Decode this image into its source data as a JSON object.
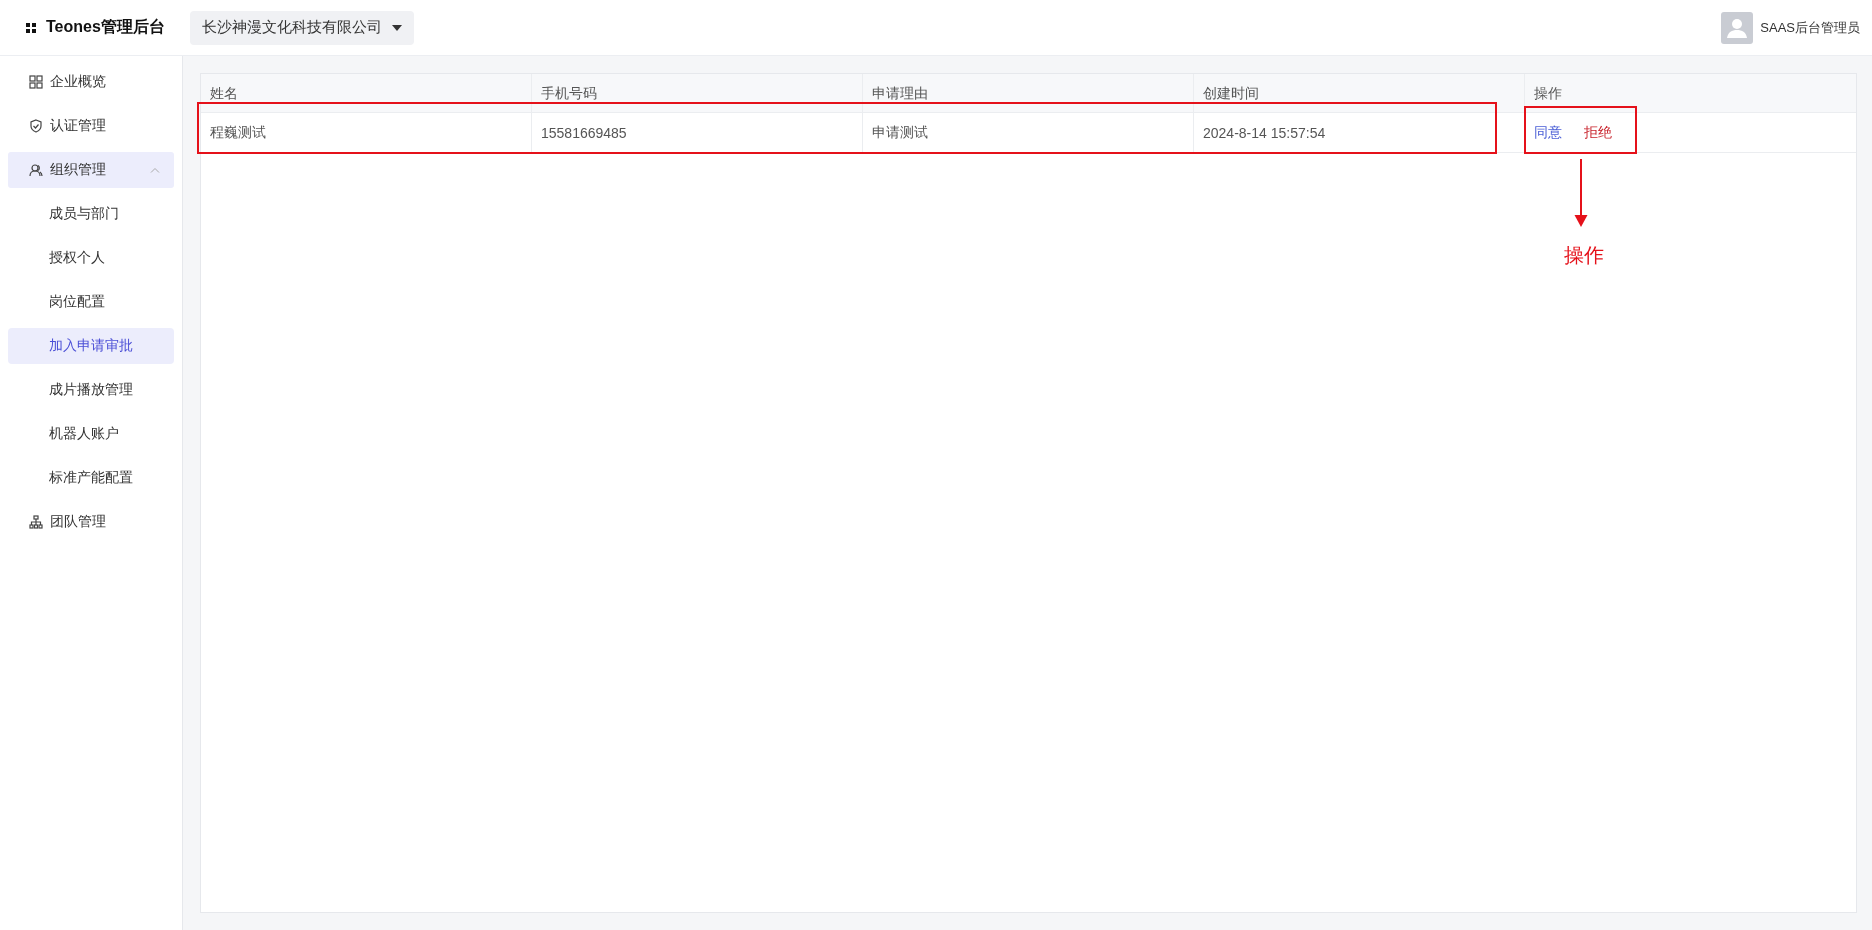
{
  "header": {
    "brand": "Teones管理后台",
    "company_select": {
      "value": "长沙神漫文化科技有限公司"
    },
    "user": {
      "name": "SAAS后台管理员"
    }
  },
  "sidebar": {
    "items": [
      {
        "label": "企业概览",
        "selected": false
      },
      {
        "label": "认证管理",
        "selected": false
      },
      {
        "label": "组织管理",
        "selected": false,
        "expanded": true,
        "children": [
          {
            "label": "成员与部门",
            "selected": false
          },
          {
            "label": "授权个人",
            "selected": false
          },
          {
            "label": "岗位配置",
            "selected": false
          },
          {
            "label": "加入申请审批",
            "selected": true
          },
          {
            "label": "成片播放管理",
            "selected": false
          },
          {
            "label": "机器人账户",
            "selected": false
          },
          {
            "label": "标准产能配置",
            "selected": false
          }
        ]
      },
      {
        "label": "团队管理",
        "selected": false
      }
    ]
  },
  "table": {
    "columns": [
      "姓名",
      "手机号码",
      "申请理由",
      "创建时间",
      "操作"
    ],
    "rows": [
      {
        "cells": [
          "程巍测试",
          "15581669485",
          "申请测试",
          "2024-8-14 15:57:54"
        ],
        "actions": [
          {
            "label": "同意",
            "color": "#4b5fd6"
          },
          {
            "label": "拒绝",
            "color": "#c8232c"
          }
        ]
      }
    ]
  },
  "annotation": {
    "label": "操作"
  }
}
